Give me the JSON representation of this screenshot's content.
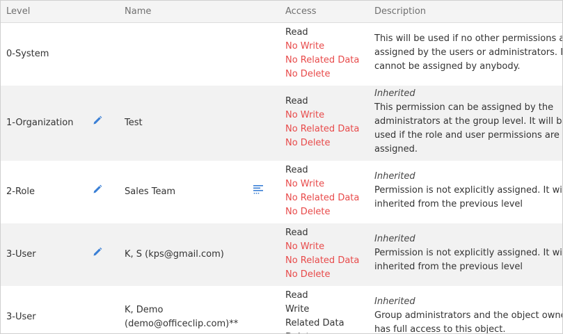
{
  "header": {
    "level": "Level",
    "name": "Name",
    "access": "Access",
    "description": "Description"
  },
  "rows": [
    {
      "level": "0-System",
      "name": "",
      "editable": false,
      "detail": false,
      "access": [
        "Read",
        "No Write",
        "No Related Data",
        "No Delete"
      ],
      "inherited": "",
      "description": "This will be used if no other permissions are assigned by the users or administrators. It cannot be assigned by anybody."
    },
    {
      "level": "1-Organization",
      "name": "Test",
      "editable": true,
      "detail": false,
      "access": [
        "Read",
        "No Write",
        "No Related Data",
        "No Delete"
      ],
      "inherited": "Inherited",
      "description": "This permission can be assigned by the administrators at the group level. It will be used if the role and user permissions are not assigned."
    },
    {
      "level": "2-Role",
      "name": "Sales Team",
      "editable": true,
      "detail": true,
      "access": [
        "Read",
        "No Write",
        "No Related Data",
        "No Delete"
      ],
      "inherited": "Inherited",
      "description": "Permission is not explicitly assigned. It will be inherited from the previous level"
    },
    {
      "level": "3-User",
      "name": "K, S (kps@gmail.com)",
      "editable": true,
      "detail": false,
      "access": [
        "Read",
        "No Write",
        "No Related Data",
        "No Delete"
      ],
      "inherited": "Inherited",
      "description": "Permission is not explicitly assigned. It will be inherited from the previous level"
    },
    {
      "level": "3-User",
      "name": "K, Demo (demo@officeclip.com)**",
      "editable": false,
      "detail": false,
      "access": [
        "Read",
        "Write",
        "Related Data",
        "Delete"
      ],
      "inherited": "Inherited",
      "description": "Group administrators and the object owner has full access to this object."
    }
  ],
  "colors": {
    "deny": "#e84a4a",
    "allow": "#333333",
    "icon": "#3a7fd5",
    "header_bg": "#f4f4f4",
    "stripe_bg": "#f2f2f2"
  },
  "icons": {
    "edit": "pencil-icon",
    "detail": "detail-list-icon"
  }
}
